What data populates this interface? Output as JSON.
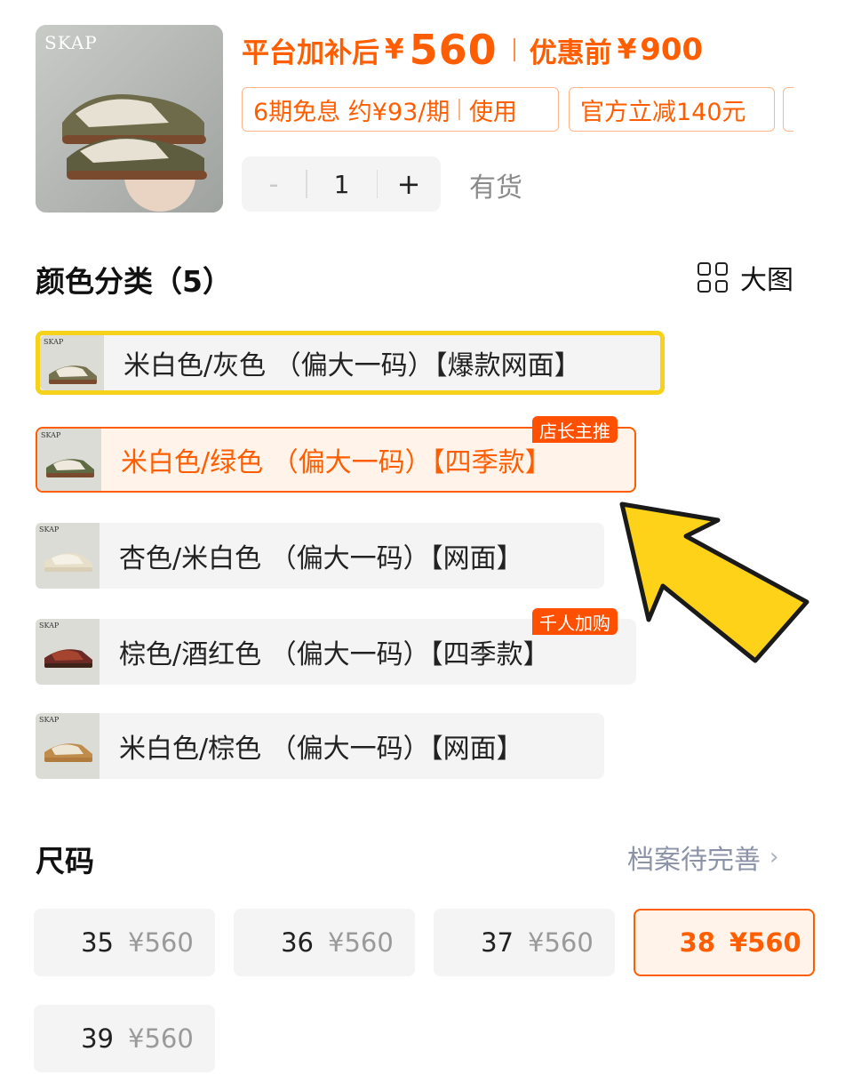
{
  "product": {
    "thumb_brand": "SKAP",
    "price_label": "平台加补后",
    "currency": "¥",
    "price": "560",
    "original_label": "优惠前",
    "original_price": "900"
  },
  "promos": {
    "installment": "6期免息 约¥93/期",
    "installment_action": "使用",
    "discount": "官方立减140元"
  },
  "quantity": {
    "minus": "-",
    "value": "1",
    "plus": "+"
  },
  "stock": "有货",
  "color_section": {
    "title": "颜色分类（5）",
    "view_toggle": "大图",
    "options": [
      {
        "label": "米白色/灰色 （偏大一码）【爆款网面】",
        "tag": "",
        "state": "highlighted"
      },
      {
        "label": "米白色/绿色 （偏大一码）【四季款】",
        "tag": "店长主推",
        "state": "selected"
      },
      {
        "label": "杏色/米白色 （偏大一码）【网面】",
        "tag": "",
        "state": "normal"
      },
      {
        "label": "棕色/酒红色 （偏大一码）【四季款】",
        "tag": "千人加购",
        "state": "normal"
      },
      {
        "label": "米白色/棕色 （偏大一码）【网面】",
        "tag": "",
        "state": "normal"
      }
    ]
  },
  "size_section": {
    "title": "尺码",
    "profile_link": "档案待完善",
    "sizes": [
      {
        "size": "35",
        "price": "¥560",
        "state": "normal"
      },
      {
        "size": "36",
        "price": "¥560",
        "state": "normal"
      },
      {
        "size": "37",
        "price": "¥560",
        "state": "normal"
      },
      {
        "size": "38",
        "price": "¥560",
        "state": "selected"
      },
      {
        "size": "39",
        "price": "¥560",
        "state": "normal"
      }
    ]
  },
  "colors": {
    "accent": "#ff5e00",
    "highlight": "#f7d21a",
    "arrow": "#ffd21a"
  },
  "icons": {
    "view_toggle": "grid-icon",
    "profile_link": "chevron-right-icon",
    "annotation": "arrow-pointer-icon"
  }
}
